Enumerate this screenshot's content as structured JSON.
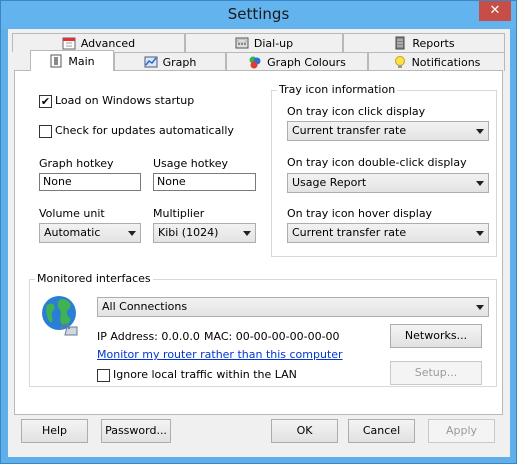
{
  "window": {
    "title": "Settings",
    "close_glyph": "✕"
  },
  "tabs_back": [
    "Advanced",
    "Dial-up",
    "Reports"
  ],
  "tabs_front": [
    "Main",
    "Graph",
    "Graph Colours",
    "Notifications"
  ],
  "main": {
    "load_on_startup": {
      "label": "Load on Windows startup",
      "checked": true,
      "mark": "✔"
    },
    "check_updates": {
      "label": "Check for updates automatically",
      "checked": false,
      "mark": ""
    },
    "graph_hotkey": {
      "label": "Graph hotkey",
      "value": "None"
    },
    "usage_hotkey": {
      "label": "Usage hotkey",
      "value": "None"
    },
    "volume_unit": {
      "label": "Volume unit",
      "value": "Automatic"
    },
    "multiplier": {
      "label": "Multiplier",
      "value": "Kibi (1024)"
    }
  },
  "tray": {
    "group_title": "Tray icon information",
    "click": {
      "label": "On tray icon click display",
      "value": "Current transfer rate"
    },
    "double_click": {
      "label": "On tray icon double-click display",
      "value": "Usage Report"
    },
    "hover": {
      "label": "On tray icon hover display",
      "value": "Current transfer rate"
    }
  },
  "monitored": {
    "group_title": "Monitored interfaces",
    "interface": "All Connections",
    "ip_address": "IP Address: 0.0.0.0",
    "mac": "MAC: 00-00-00-00-00-00",
    "networks_button": "Networks...",
    "router_link": "Monitor my router rather than this computer",
    "ignore_local": {
      "label": "Ignore local traffic within the LAN",
      "checked": false
    },
    "setup_button": "Setup..."
  },
  "footer": {
    "help": "Help",
    "password": "Password...",
    "ok": "OK",
    "cancel": "Cancel",
    "apply": "Apply"
  }
}
